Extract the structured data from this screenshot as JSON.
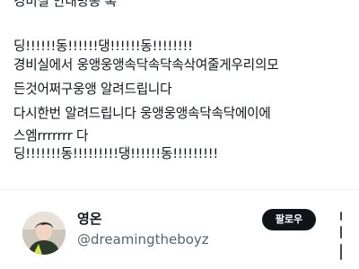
{
  "post": {
    "lines": [
      "경비실 안내방송 록",
      "딩!!!!!!동!!!!!!댕!!!!!!동!!!!!!!!",
      "경비실에서 웅앵웅앵속닥속닥속삭여줄게우리의모",
      "든것어쩌구웅앵 알려드립니다",
      "다시한번 알려드립니다 웅앵웅앵속닥속닥에이에",
      "스엠rrrrrrr 다",
      "딩!!!!!!!동!!!!!!!!!댕!!!!!!동!!!!!!!!!"
    ]
  },
  "author": {
    "display_name": "영온",
    "handle": "@dreamingtheboyz",
    "follow_label": "팔로우",
    "avatar_icon": "profile-photo",
    "more_icon": "vertical-dots-icon"
  },
  "colors": {
    "text": "#0f1419",
    "secondary_text": "#536471",
    "follow_bg": "#0f1419",
    "follow_text": "#ffffff",
    "divider": "#eff3f4"
  }
}
